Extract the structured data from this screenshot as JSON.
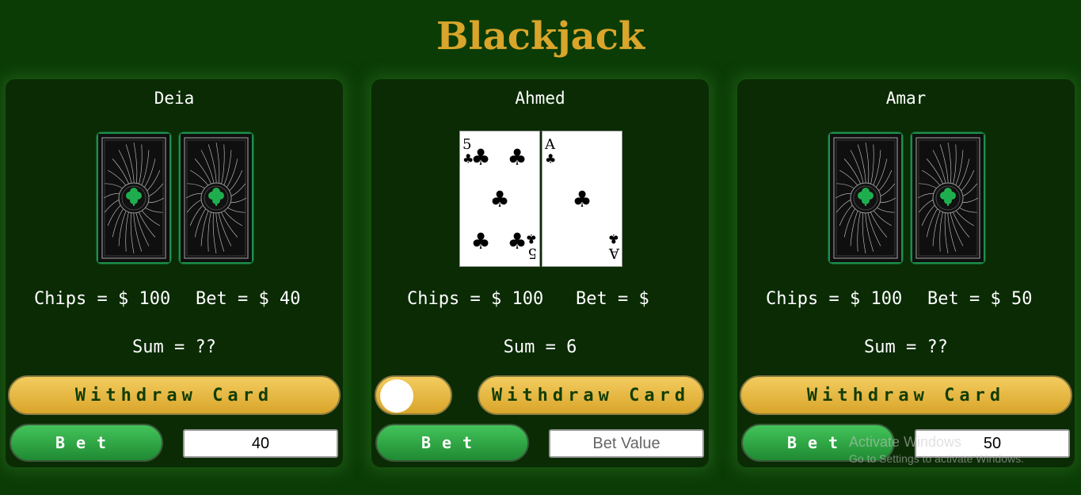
{
  "title": "Blackjack",
  "players": [
    {
      "name": "Deia",
      "cards": [
        "card-back",
        "card-back"
      ],
      "chips_text": "Chips = $ 100",
      "bet_text": "Bet = $ 40",
      "sum_text": "Sum = ??",
      "withdraw_label": "Withdraw Card",
      "bet_label": "Bet",
      "bet_value": "40",
      "bet_placeholder": "Bet Value"
    },
    {
      "name": "Ahmed",
      "cards": [
        {
          "rank": "5",
          "suit": "♣"
        },
        {
          "rank": "A",
          "suit": "♣"
        }
      ],
      "chips_text": "Chips = $ 100",
      "bet_text": "Bet = $",
      "sum_text": "Sum = 6",
      "withdraw_label": "Withdraw Card",
      "bet_label": "Bet",
      "bet_value": "",
      "bet_placeholder": "Bet Value",
      "toggle_on": false
    },
    {
      "name": "Amar",
      "cards": [
        "card-back",
        "card-back"
      ],
      "chips_text": "Chips = $ 100",
      "bet_text": "Bet = $ 50",
      "sum_text": "Sum = ??",
      "withdraw_label": "Withdraw Card",
      "bet_label": "Bet",
      "bet_value": "50",
      "bet_placeholder": "Bet Value"
    }
  ],
  "watermark": {
    "line1": "Activate Windows",
    "line2": "Go to Settings to activate Windows."
  },
  "colors": {
    "background": "#0b3c06",
    "panel": "#0a2b04",
    "gold": "#d9a52b",
    "green_button": "#2fa845",
    "card_back_accent": "#1e8f4a"
  }
}
